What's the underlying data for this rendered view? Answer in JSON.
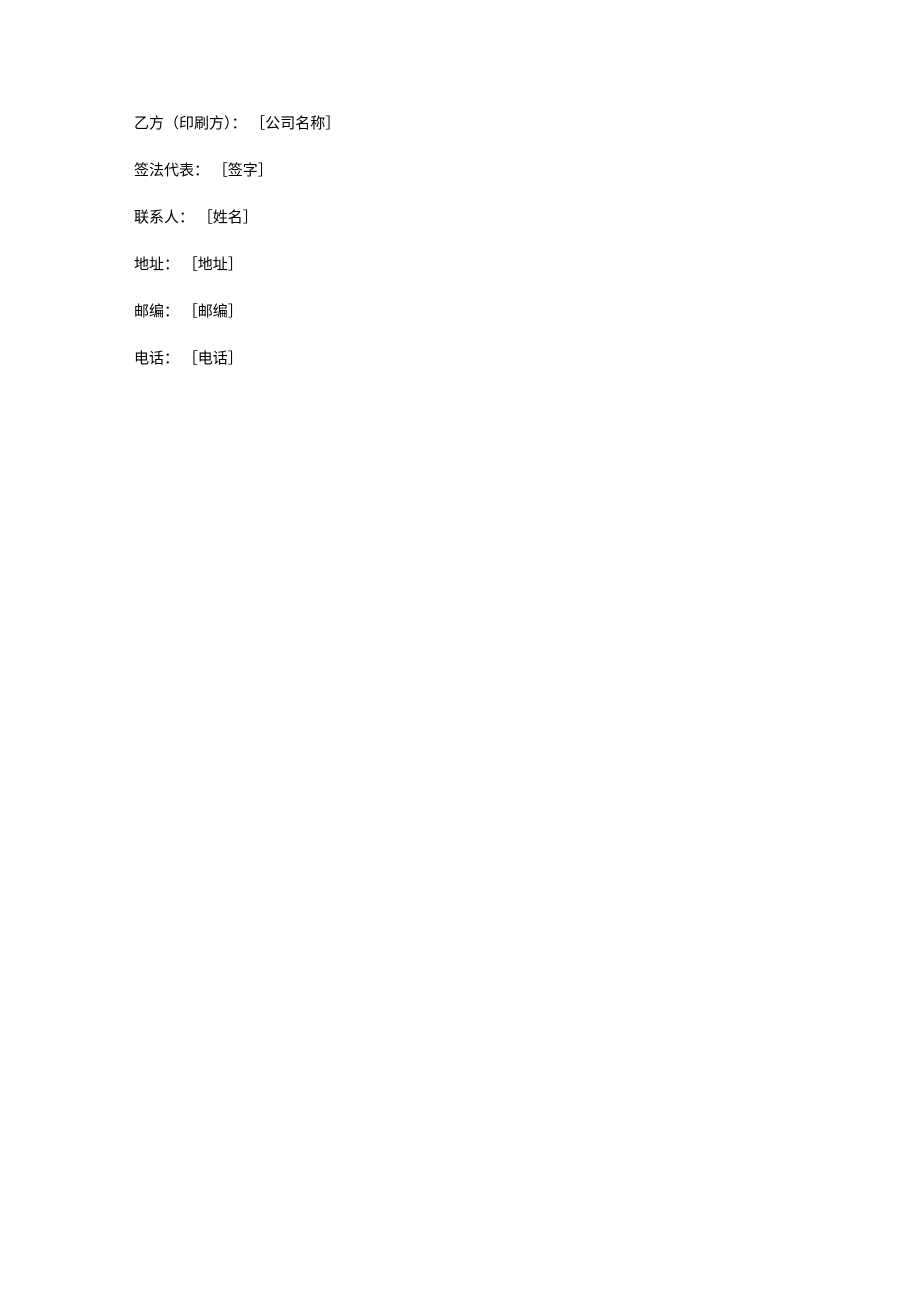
{
  "party_b": {
    "label": "乙方（印刷方）：",
    "value": "［公司名称］"
  },
  "representative": {
    "label": "签法代表：",
    "value": "［签字］"
  },
  "contact": {
    "label": "联系人：",
    "value": "［姓名］"
  },
  "address": {
    "label": "地址：",
    "value": "［地址］"
  },
  "postal_code": {
    "label": "邮编：",
    "value": "［邮编］"
  },
  "phone": {
    "label": "电话：",
    "value": "［电话］"
  }
}
